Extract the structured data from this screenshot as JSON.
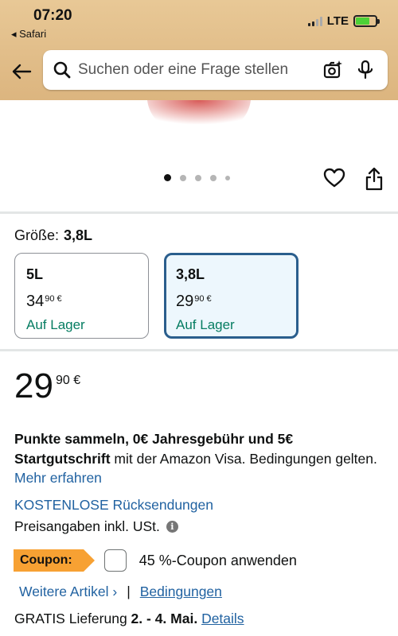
{
  "status_bar": {
    "time": "07:20",
    "back_app": "◂ Safari",
    "network": "LTE"
  },
  "search": {
    "placeholder": "Suchen oder eine Frage stellen"
  },
  "carousel": {
    "dot_count": 5,
    "active_index": 0
  },
  "size": {
    "label": "Größe:",
    "selected": "3,8L",
    "options": [
      {
        "name": "5L",
        "price_whole": "34",
        "price_fraction": "90 €",
        "stock": "Auf Lager",
        "selected": false
      },
      {
        "name": "3,8L",
        "price_whole": "29",
        "price_fraction": "90 €",
        "stock": "Auf Lager",
        "selected": true
      }
    ]
  },
  "price": {
    "whole": "29",
    "fraction": "90 €"
  },
  "promo": {
    "bold": "Punkte sammeln, 0€ Jahresgebühr und 5€ Startgutschrift",
    "text": " mit der Amazon Visa. Bedingungen gelten. ",
    "link": "Mehr erfahren"
  },
  "returns": "KOSTENLOSE Rücksendungen",
  "tax_note": "Preisangaben inkl. USt.",
  "coupon": {
    "badge": "Coupon:",
    "text": "45 %-Coupon anwenden",
    "checked": false
  },
  "links": {
    "more_items": "Weitere Artikel ›",
    "separator": "|",
    "terms": "Bedingungen"
  },
  "delivery": {
    "prefix": "GRATIS Lieferung ",
    "dates": "2. - 4. Mai.",
    "details": "Details"
  },
  "colors": {
    "header": "#dcb57f",
    "link": "#2162a1",
    "stock": "#067d62",
    "coupon": "#f7a133",
    "selected_border": "#2a5e8d"
  }
}
